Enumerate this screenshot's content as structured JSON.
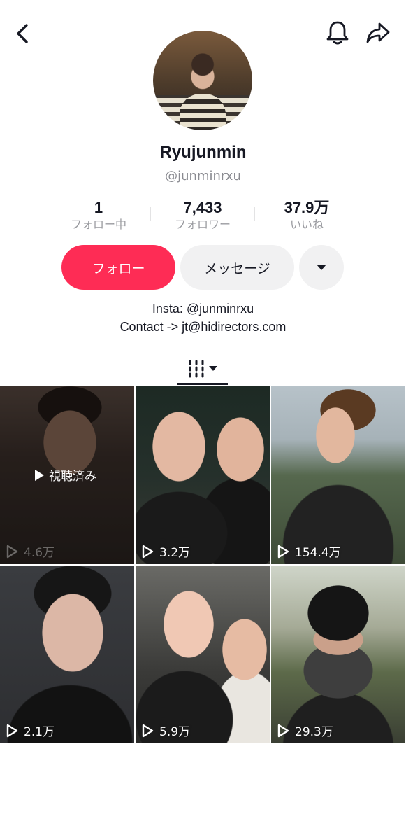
{
  "header": {
    "back_icon": "chevron-left-icon",
    "bell_icon": "bell-icon",
    "share_icon": "share-icon"
  },
  "profile": {
    "name": "Ryujunmin",
    "handle": "@junminrxu"
  },
  "stats": [
    {
      "value": "1",
      "label": "フォロー中"
    },
    {
      "value": "7,433",
      "label": "フォロワー"
    },
    {
      "value": "37.9万",
      "label": "いいね"
    }
  ],
  "actions": {
    "follow_label": "フォロー",
    "message_label": "メッセージ",
    "more_icon": "caret-down-icon"
  },
  "bio": {
    "line1": "Insta: @junminrxu",
    "line2": "Contact -> jt@hidirectors.com"
  },
  "tabs": {
    "grid_icon": "videos-grid-icon"
  },
  "videos": [
    {
      "views": "4.6万",
      "badge": "視聴済み"
    },
    {
      "views": "3.2万"
    },
    {
      "views": "154.4万"
    },
    {
      "views": "2.1万"
    },
    {
      "views": "5.9万"
    },
    {
      "views": "29.3万"
    }
  ],
  "colors": {
    "accent": "#fe2c55",
    "secondary_button": "#f1f1f2",
    "text": "#161823",
    "muted": "#8a8b91"
  }
}
